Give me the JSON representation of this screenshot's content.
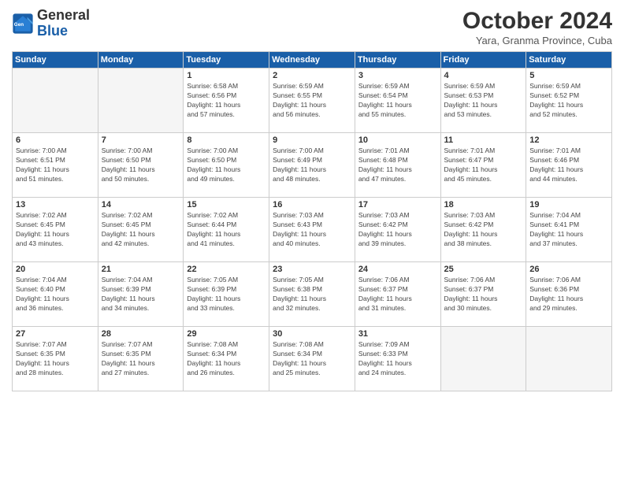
{
  "logo": {
    "line1": "General",
    "line2": "Blue"
  },
  "title": "October 2024",
  "subtitle": "Yara, Granma Province, Cuba",
  "weekdays": [
    "Sunday",
    "Monday",
    "Tuesday",
    "Wednesday",
    "Thursday",
    "Friday",
    "Saturday"
  ],
  "weeks": [
    [
      {
        "day": "",
        "info": ""
      },
      {
        "day": "",
        "info": ""
      },
      {
        "day": "1",
        "info": "Sunrise: 6:58 AM\nSunset: 6:56 PM\nDaylight: 11 hours\nand 57 minutes."
      },
      {
        "day": "2",
        "info": "Sunrise: 6:59 AM\nSunset: 6:55 PM\nDaylight: 11 hours\nand 56 minutes."
      },
      {
        "day": "3",
        "info": "Sunrise: 6:59 AM\nSunset: 6:54 PM\nDaylight: 11 hours\nand 55 minutes."
      },
      {
        "day": "4",
        "info": "Sunrise: 6:59 AM\nSunset: 6:53 PM\nDaylight: 11 hours\nand 53 minutes."
      },
      {
        "day": "5",
        "info": "Sunrise: 6:59 AM\nSunset: 6:52 PM\nDaylight: 11 hours\nand 52 minutes."
      }
    ],
    [
      {
        "day": "6",
        "info": "Sunrise: 7:00 AM\nSunset: 6:51 PM\nDaylight: 11 hours\nand 51 minutes."
      },
      {
        "day": "7",
        "info": "Sunrise: 7:00 AM\nSunset: 6:50 PM\nDaylight: 11 hours\nand 50 minutes."
      },
      {
        "day": "8",
        "info": "Sunrise: 7:00 AM\nSunset: 6:50 PM\nDaylight: 11 hours\nand 49 minutes."
      },
      {
        "day": "9",
        "info": "Sunrise: 7:00 AM\nSunset: 6:49 PM\nDaylight: 11 hours\nand 48 minutes."
      },
      {
        "day": "10",
        "info": "Sunrise: 7:01 AM\nSunset: 6:48 PM\nDaylight: 11 hours\nand 47 minutes."
      },
      {
        "day": "11",
        "info": "Sunrise: 7:01 AM\nSunset: 6:47 PM\nDaylight: 11 hours\nand 45 minutes."
      },
      {
        "day": "12",
        "info": "Sunrise: 7:01 AM\nSunset: 6:46 PM\nDaylight: 11 hours\nand 44 minutes."
      }
    ],
    [
      {
        "day": "13",
        "info": "Sunrise: 7:02 AM\nSunset: 6:45 PM\nDaylight: 11 hours\nand 43 minutes."
      },
      {
        "day": "14",
        "info": "Sunrise: 7:02 AM\nSunset: 6:45 PM\nDaylight: 11 hours\nand 42 minutes."
      },
      {
        "day": "15",
        "info": "Sunrise: 7:02 AM\nSunset: 6:44 PM\nDaylight: 11 hours\nand 41 minutes."
      },
      {
        "day": "16",
        "info": "Sunrise: 7:03 AM\nSunset: 6:43 PM\nDaylight: 11 hours\nand 40 minutes."
      },
      {
        "day": "17",
        "info": "Sunrise: 7:03 AM\nSunset: 6:42 PM\nDaylight: 11 hours\nand 39 minutes."
      },
      {
        "day": "18",
        "info": "Sunrise: 7:03 AM\nSunset: 6:42 PM\nDaylight: 11 hours\nand 38 minutes."
      },
      {
        "day": "19",
        "info": "Sunrise: 7:04 AM\nSunset: 6:41 PM\nDaylight: 11 hours\nand 37 minutes."
      }
    ],
    [
      {
        "day": "20",
        "info": "Sunrise: 7:04 AM\nSunset: 6:40 PM\nDaylight: 11 hours\nand 36 minutes."
      },
      {
        "day": "21",
        "info": "Sunrise: 7:04 AM\nSunset: 6:39 PM\nDaylight: 11 hours\nand 34 minutes."
      },
      {
        "day": "22",
        "info": "Sunrise: 7:05 AM\nSunset: 6:39 PM\nDaylight: 11 hours\nand 33 minutes."
      },
      {
        "day": "23",
        "info": "Sunrise: 7:05 AM\nSunset: 6:38 PM\nDaylight: 11 hours\nand 32 minutes."
      },
      {
        "day": "24",
        "info": "Sunrise: 7:06 AM\nSunset: 6:37 PM\nDaylight: 11 hours\nand 31 minutes."
      },
      {
        "day": "25",
        "info": "Sunrise: 7:06 AM\nSunset: 6:37 PM\nDaylight: 11 hours\nand 30 minutes."
      },
      {
        "day": "26",
        "info": "Sunrise: 7:06 AM\nSunset: 6:36 PM\nDaylight: 11 hours\nand 29 minutes."
      }
    ],
    [
      {
        "day": "27",
        "info": "Sunrise: 7:07 AM\nSunset: 6:35 PM\nDaylight: 11 hours\nand 28 minutes."
      },
      {
        "day": "28",
        "info": "Sunrise: 7:07 AM\nSunset: 6:35 PM\nDaylight: 11 hours\nand 27 minutes."
      },
      {
        "day": "29",
        "info": "Sunrise: 7:08 AM\nSunset: 6:34 PM\nDaylight: 11 hours\nand 26 minutes."
      },
      {
        "day": "30",
        "info": "Sunrise: 7:08 AM\nSunset: 6:34 PM\nDaylight: 11 hours\nand 25 minutes."
      },
      {
        "day": "31",
        "info": "Sunrise: 7:09 AM\nSunset: 6:33 PM\nDaylight: 11 hours\nand 24 minutes."
      },
      {
        "day": "",
        "info": ""
      },
      {
        "day": "",
        "info": ""
      }
    ]
  ]
}
